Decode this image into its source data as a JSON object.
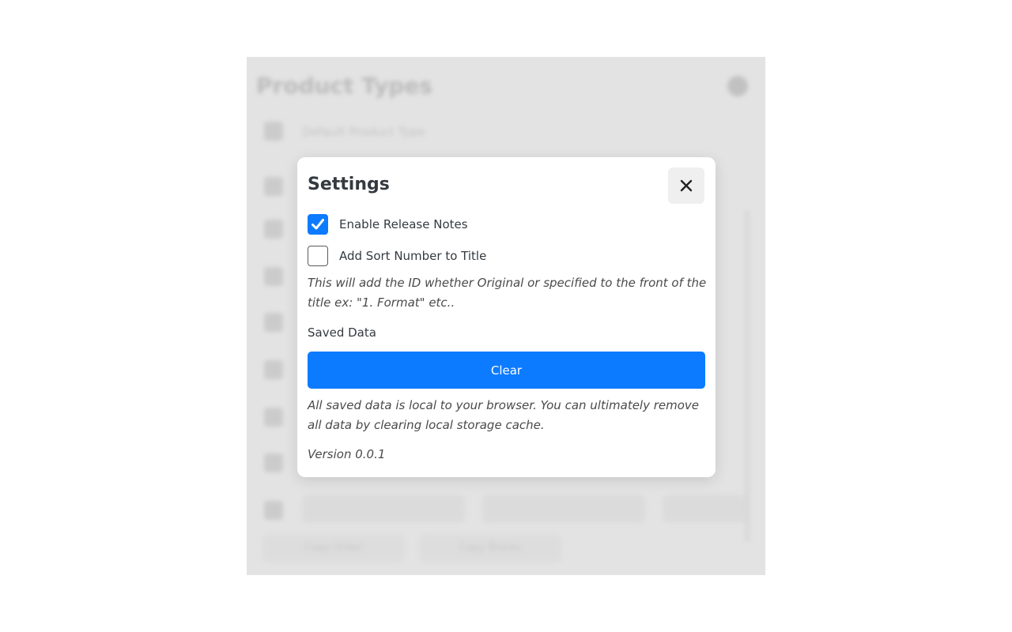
{
  "background": {
    "title": "Product Types",
    "subtitle": "Default Product Type",
    "bottom_buttons": [
      "Copy Order",
      "Copy Blocks"
    ]
  },
  "modal": {
    "title": "Settings",
    "close_icon": "close-icon",
    "options": [
      {
        "label": "Enable Release Notes",
        "checked": true
      },
      {
        "label": "Add Sort Number to Title",
        "checked": false
      }
    ],
    "sort_hint": "This will add the ID whether Original or specified to the front of the title ex: \"1. Format\" etc..",
    "saved_data_label": "Saved Data",
    "clear_button": "Clear",
    "storage_hint": "All saved data is local to your browser. You can ultimately remove all data by clearing local storage cache.",
    "version": "Version 0.0.1"
  },
  "colors": {
    "accent": "#0d7bff",
    "overlay": "#e3e3e3",
    "text": "#343a40"
  }
}
